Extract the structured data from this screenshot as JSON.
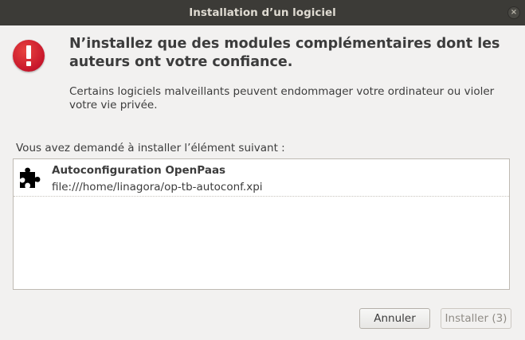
{
  "window": {
    "title": "Installation d’un logiciel",
    "close_symbol": "×"
  },
  "dialog": {
    "icon": "warning-icon",
    "heading": "N’installez que des modules complémentaires dont les auteurs ont votre confiance.",
    "message": "Certains logiciels malveillants peuvent endommager votre ordinateur ou violer votre vie privée.",
    "list_caption": "Vous avez demandé à installer l’élément suivant :",
    "items": [
      {
        "icon": "puzzle-piece-icon",
        "name": "Autoconfiguration OpenPaas",
        "path": "file:///home/linagora/op-tb-autoconf.xpi"
      }
    ]
  },
  "buttons": {
    "cancel_label": "Annuler",
    "install_label": "Installer (3)"
  },
  "colors": {
    "titlebar": "#3c3b37",
    "warning": "#c7162b",
    "background": "#f2f1f0"
  }
}
